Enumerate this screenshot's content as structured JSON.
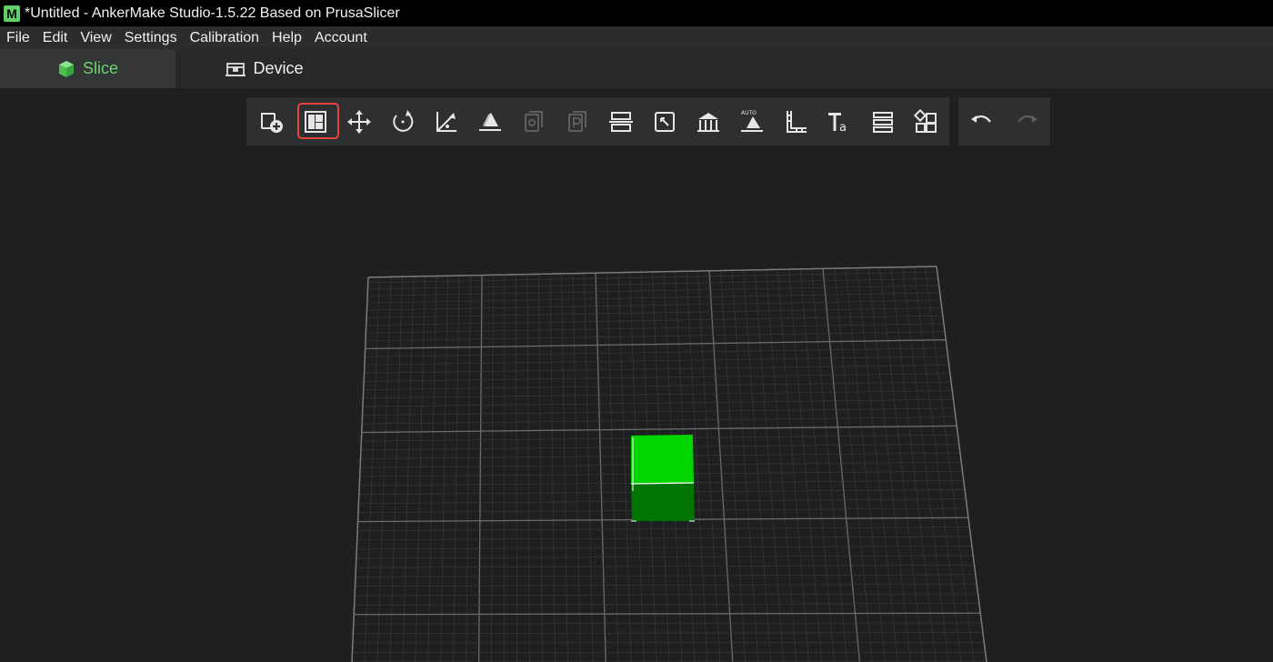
{
  "window": {
    "title": "*Untitled - AnkerMake Studio-1.5.22 Based on PrusaSlicer",
    "app_icon_letter": "M"
  },
  "menu": [
    "File",
    "Edit",
    "View",
    "Settings",
    "Calibration",
    "Help",
    "Account"
  ],
  "tabs": {
    "slice": "Slice",
    "device": "Device"
  },
  "toolbar": {
    "tools": [
      "add-object-icon",
      "arrange-icon",
      "move-icon",
      "rotate-icon",
      "scale-icon",
      "place-on-face-icon",
      "copy-icon",
      "paste-icon",
      "cut-icon",
      "support-paint-icon",
      "seam-paint-icon",
      "auto-orient-icon",
      "measure-icon",
      "text-icon",
      "layers-icon",
      "shapes-icon"
    ],
    "selected_tool": "arrange-icon",
    "undo": "undo-icon",
    "redo": "redo-icon"
  },
  "colors": {
    "accent": "#6bd36f",
    "selection": "#e8433f",
    "object_top": "#00d400",
    "object_side": "#007000"
  }
}
